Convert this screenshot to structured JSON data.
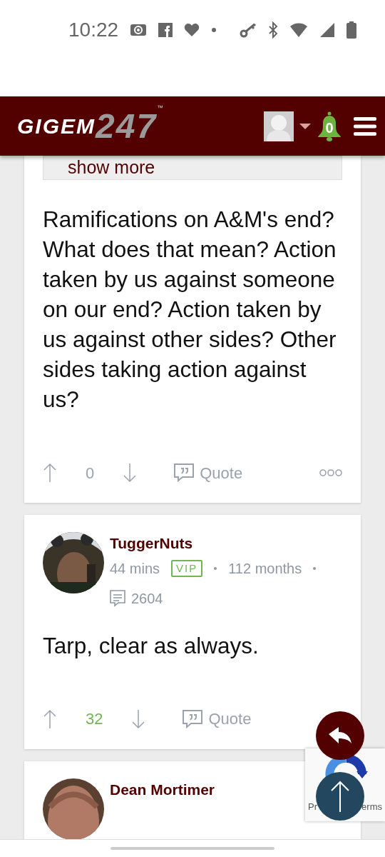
{
  "status_bar": {
    "time": "10:22"
  },
  "navbar": {
    "logo": {
      "word": "GIGEM",
      "number": "247",
      "mark": "™"
    },
    "notifications": "0"
  },
  "posts": [
    {
      "show_more": "show more",
      "body": "Ramifications on A&M's end? What does that mean? Action taken by us against someone on our end? Action taken by us against other sides? Other sides taking action against us?",
      "score": {
        "text": "0",
        "color": "#9aa3ad"
      },
      "quote": "Quote",
      "more_menu": true
    },
    {
      "author": "TuggerNuts",
      "time": "44 mins",
      "badge": "VIP",
      "tenure": "112 months",
      "post_count": "2604",
      "body": "Tarp, clear as always.",
      "score": {
        "text": "32",
        "color": "#74b553"
      },
      "quote": "Quote"
    },
    {
      "author": "Dean Mortimer"
    }
  ],
  "recaptcha": {
    "left_text": "Pr",
    "right_text": "erms"
  }
}
